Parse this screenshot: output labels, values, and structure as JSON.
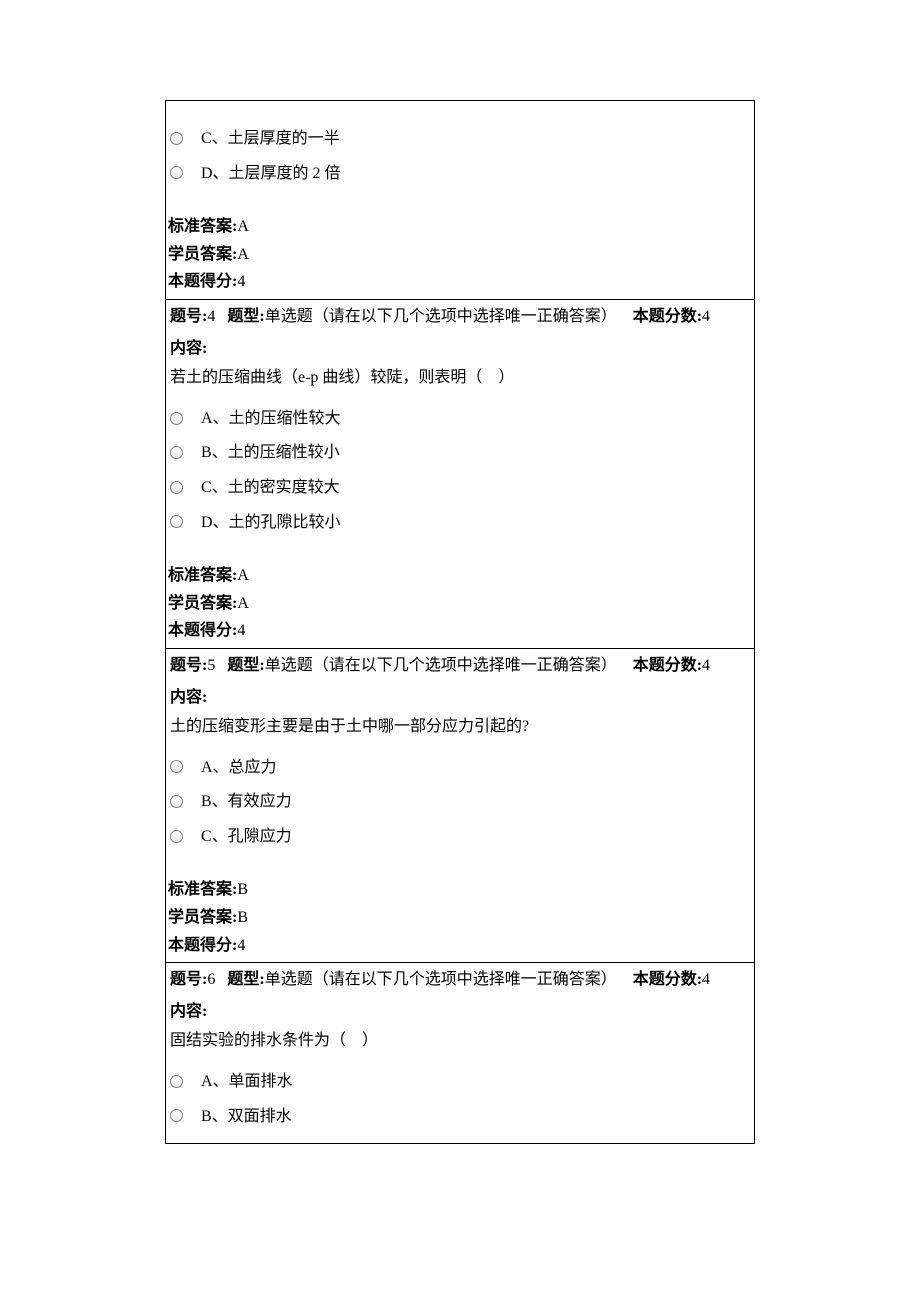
{
  "labels": {
    "question_no": "题号:",
    "question_type": "题型:",
    "single_choice_desc": "单选题（请在以下几个选项中选择唯一正确答案）",
    "question_score_label": "本题分数:",
    "content_label": "内容:",
    "standard_answer_label": "标准答案:",
    "student_answer_label": "学员答案:",
    "score_gained_label": "本题得分:"
  },
  "q3_partial": {
    "options": [
      {
        "text": "C、土层厚度的一半"
      },
      {
        "text": "D、土层厚度的 2 倍"
      }
    ],
    "standard_answer": "A",
    "student_answer": "A",
    "score_gained": "4"
  },
  "questions": [
    {
      "number": "4",
      "score": "4",
      "body": "若土的压缩曲线（e-p 曲线）较陡，则表明（    ）",
      "options": [
        {
          "text": "A、土的压缩性较大"
        },
        {
          "text": "B、土的压缩性较小"
        },
        {
          "text": "C、土的密实度较大"
        },
        {
          "text": "D、土的孔隙比较小"
        }
      ],
      "standard_answer": "A",
      "student_answer": "A",
      "score_gained": "4"
    },
    {
      "number": "5",
      "score": "4",
      "body": "土的压缩变形主要是由于土中哪一部分应力引起的?",
      "options": [
        {
          "text": "A、总应力"
        },
        {
          "text": "B、有效应力"
        },
        {
          "text": "C、孔隙应力"
        }
      ],
      "standard_answer": "B",
      "student_answer": "B",
      "score_gained": "4"
    },
    {
      "number": "6",
      "score": "4",
      "body": "固结实验的排水条件为（    ）",
      "options": [
        {
          "text": "A、单面排水"
        },
        {
          "text": "B、双面排水"
        }
      ]
    }
  ]
}
